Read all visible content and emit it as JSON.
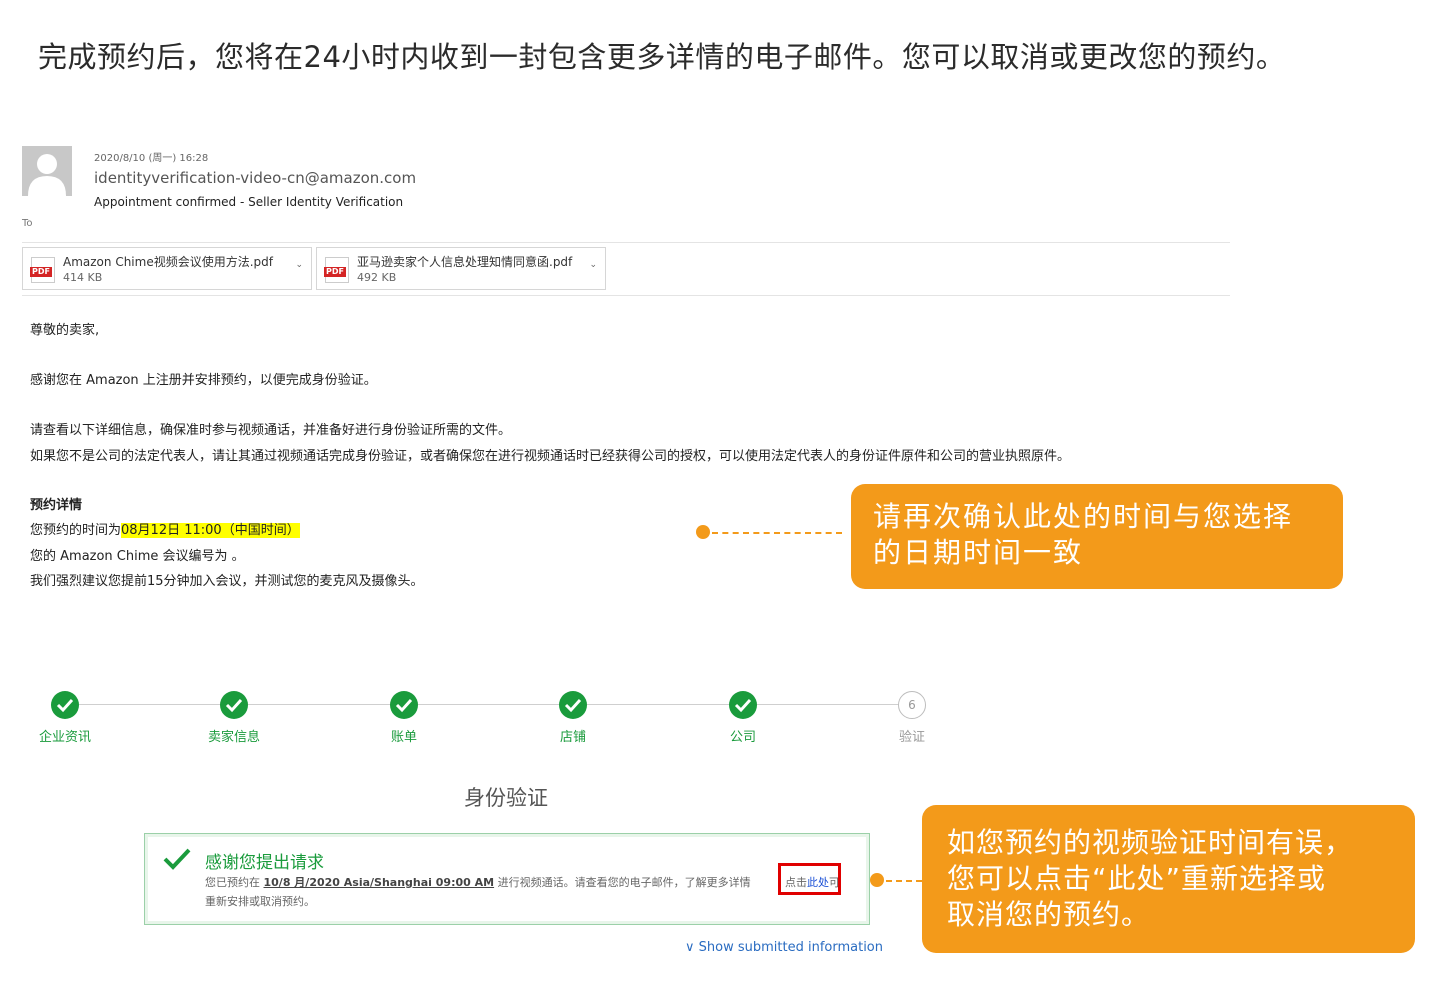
{
  "headline": "完成预约后，您将在24小时内收到一封包含更多详情的电子邮件。您可以取消或更改您的预约。",
  "email": {
    "date": "2020/8/10 (周一) 16:28",
    "from": "identityverification-video-cn@amazon.com",
    "subject": "Appointment confirmed - Seller Identity Verification",
    "to_label": "To",
    "attachments": [
      {
        "name": "Amazon Chime视频会议使用方法.pdf",
        "size": "414 KB",
        "badge": "PDF"
      },
      {
        "name": "亚马逊卖家个人信息处理知情同意函.pdf",
        "size": "492 KB",
        "badge": "PDF"
      }
    ],
    "greeting": "尊敬的卖家,",
    "para1": "感谢您在 Amazon 上注册并安排预约，以便完成身份验证。",
    "para2_line1": "请查看以下详细信息，确保准时参与视频通话，并准备好进行身份验证所需的文件。",
    "para2_line2": "如果您不是公司的法定代表人，请让其通过视频通话完成身份验证，或者确保您在进行视频通话时已经获得公司的授权，可以使用法定代表人的身份证件原件和公司的营业执照原件。",
    "details_heading": "预约详情",
    "time_prefix": "您预约的时间为",
    "time_value": "08月12日 11:00（中国时间）",
    "meeting_id": "您的 Amazon Chime 会议编号为                         。",
    "advice": "我们强烈建议您提前15分钟加入会议，并测试您的麦克风及摄像头。"
  },
  "callouts": {
    "first": [
      "请再次确认此处的时间与您选择",
      "的日期时间一致"
    ],
    "second": [
      "如您预约的视频验证时间有误，",
      "您可以点击“此处”重新选择或",
      "取消您的预约。"
    ]
  },
  "steps": [
    {
      "label": "企业资讯",
      "done": true
    },
    {
      "label": "卖家信息",
      "done": true
    },
    {
      "label": "账单",
      "done": true
    },
    {
      "label": "店铺",
      "done": true
    },
    {
      "label": "公司",
      "done": true
    },
    {
      "label": "验证",
      "done": false,
      "number": "6"
    }
  ],
  "verification": {
    "title": "身份验证",
    "alert_title": "感谢您提出请求",
    "line1_prefix": "您已预约在",
    "line1_datetime": "10/8 月/2020 Asia/Shanghai 09:00 AM",
    "line1_suffix": "进行视频通话。请查看您的电子邮件，了解更多详情",
    "link_prefix": "点击",
    "link_text": "此处",
    "link_suffix": "可",
    "line2": "重新安排或取消预约。",
    "show_more": "∨ Show submitted information"
  },
  "colors": {
    "accent_orange": "#f39a1a",
    "success_green": "#1a9b3c",
    "highlight_yellow": "#ffff00",
    "link_blue": "#1a4fd6",
    "marker_red": "#e00000"
  }
}
